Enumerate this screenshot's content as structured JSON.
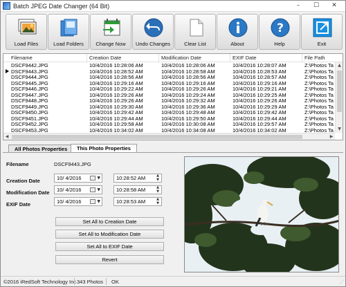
{
  "window": {
    "title": "Batch JPEG Date Changer (64 Bit)",
    "controls": {
      "minimize": "–",
      "maximize": "☐",
      "close": "✕"
    }
  },
  "toolbar": {
    "buttons": [
      {
        "label": "Load Files",
        "icon": "photo-stack-icon"
      },
      {
        "label": "Load Folders",
        "icon": "folder-icon"
      },
      {
        "label": "Change Now",
        "icon": "calendar-change-icon"
      },
      {
        "label": "Undo Changes",
        "icon": "undo-icon"
      },
      {
        "label": "Clear List",
        "icon": "blank-page-icon"
      },
      {
        "label": "About",
        "icon": "info-icon"
      },
      {
        "label": "Help",
        "icon": "help-icon"
      },
      {
        "label": "Exit",
        "icon": "exit-icon"
      }
    ]
  },
  "list": {
    "columns": [
      "Filename",
      "Creation Date",
      "Modification Date",
      "EXIF Date",
      "File Path"
    ],
    "rows": [
      [
        "DSCF9442.JPG",
        "10/4/2016 10:28:06 AM",
        "10/4/2016 10:28:06 AM",
        "10/4/2016 10:28:07 AM",
        "Z:\\Photos Ta"
      ],
      [
        "DSCF9443.JPG",
        "10/4/2016 10:28:52 AM",
        "10/4/2016 10:28:58 AM",
        "10/4/2016 10:28:53 AM",
        "Z:\\Photos Ta"
      ],
      [
        "DSCF9444.JPG",
        "10/4/2016 10:28:56 AM",
        "10/4/2016 10:28:56 AM",
        "10/4/2016 10:28:57 AM",
        "Z:\\Photos Ta"
      ],
      [
        "DSCF9445.JPG",
        "10/4/2016 10:29:16 AM",
        "10/4/2016 10:29:16 AM",
        "10/4/2016 10:29:16 AM",
        "Z:\\Photos Ta"
      ],
      [
        "DSCF9446.JPG",
        "10/4/2016 10:29:22 AM",
        "10/4/2016 10:29:26 AM",
        "10/4/2016 10:29:21 AM",
        "Z:\\Photos Ta"
      ],
      [
        "DSCF9447.JPG",
        "10/4/2016 10:29:26 AM",
        "10/4/2016 10:29:24 AM",
        "10/4/2016 10:29:25 AM",
        "Z:\\Photos Ta"
      ],
      [
        "DSCF9448.JPG",
        "10/4/2016 10:29:26 AM",
        "10/4/2016 10:29:32 AM",
        "10/4/2016 10:29:26 AM",
        "Z:\\Photos Ta"
      ],
      [
        "DSCF9449.JPG",
        "10/4/2016 10:29:30 AM",
        "10/4/2016 10:29:36 AM",
        "10/4/2016 10:29:29 AM",
        "Z:\\Photos Ta"
      ],
      [
        "DSCF9450.JPG",
        "10/4/2016 10:29:42 AM",
        "10/4/2016 10:29:48 AM",
        "10/4/2016 10:29:42 AM",
        "Z:\\Photos Ta"
      ],
      [
        "DSCF9451.JPG",
        "10/4/2016 10:29:44 AM",
        "10/4/2016 10:29:50 AM",
        "10/4/2016 10:29:44 AM",
        "Z:\\Photos Ta"
      ],
      [
        "DSCF9452.JPG",
        "10/4/2016 10:29:58 AM",
        "10/4/2016 10:30:08 AM",
        "10/4/2016 10:29:57 AM",
        "Z:\\Photos Ta"
      ],
      [
        "DSCF9453.JPG",
        "10/4/2016 10:34:02 AM",
        "10/4/2016 10:34:08 AM",
        "10/4/2016 10:34:02 AM",
        "Z:\\Photos Ta"
      ]
    ]
  },
  "tabs": [
    {
      "label": "All Photos Properties",
      "active": false
    },
    {
      "label": "This Photo Properties",
      "active": true
    }
  ],
  "properties": {
    "filename_label": "Filename",
    "filename_value": "DSCF9443.JPG",
    "creation_label": "Creation Date",
    "creation_date": "10/  4/2016",
    "creation_time": "10:28:52 AM",
    "modification_label": "Modification Date",
    "modification_date": "10/  4/2016",
    "modification_time": "10:28:58 AM",
    "exif_label": "EXIF Date",
    "exif_date": "10/  4/2016",
    "exif_time": "10:28:53 AM",
    "buttons": {
      "set_creation": "Set All to Creation Date",
      "set_modification": "Set All to Modification Date",
      "set_exif": "Set All to EXIF Date",
      "revert": "Revert"
    }
  },
  "status": {
    "copyright": "©2016 iRedSoft Technology Inc",
    "photo_count": "343 Photos",
    "state": "OK"
  },
  "colors": {
    "accent": "#2b78c5",
    "exit_blue": "#1a8fe0",
    "change_green": "#2e9b3b",
    "undo_blue": "#2a6fb8"
  }
}
